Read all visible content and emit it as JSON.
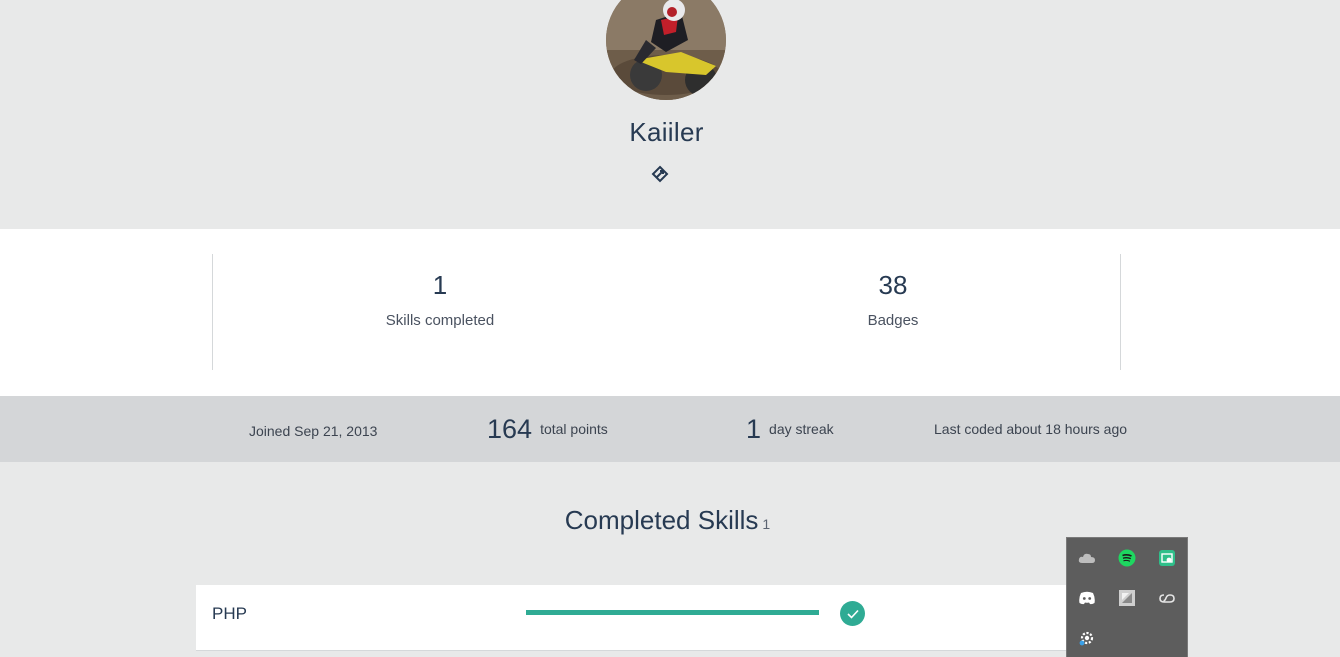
{
  "profile": {
    "username": "Kaiiler",
    "avatar_alt": "avatar"
  },
  "stats": {
    "skills_completed": {
      "value": "1",
      "label": "Skills completed"
    },
    "badges": {
      "value": "38",
      "label": "Badges"
    }
  },
  "info": {
    "joined": "Joined Sep 21, 2013",
    "points_value": "164",
    "points_label": "total points",
    "streak_value": "1",
    "streak_label": "day streak",
    "last_coded": "Last coded about 18 hours ago"
  },
  "completed": {
    "title": "Completed Skills",
    "count": "1",
    "skills": [
      {
        "name": "PHP",
        "progress_percent": 100
      }
    ]
  },
  "tray": {
    "icons": [
      "onedrive-icon",
      "spotify-icon",
      "greenshot-icon",
      "discord-icon",
      "app-icon",
      "creative-cloud-icon",
      "settings-icon"
    ]
  },
  "colors": {
    "accent": "#2fab94",
    "heading": "#273a52",
    "page_bg": "#e8e9e9",
    "strip_bg": "#d4d6d8"
  }
}
